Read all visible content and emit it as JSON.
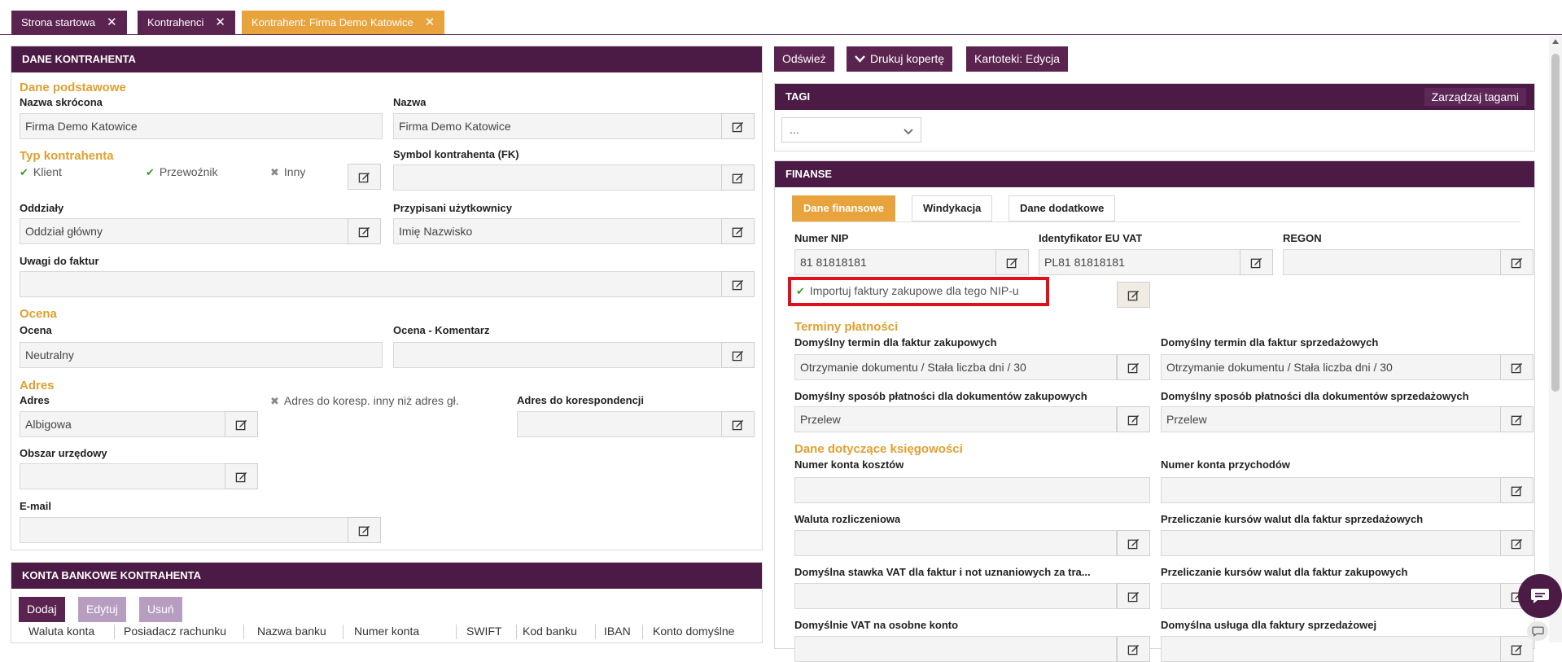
{
  "tabs": [
    {
      "label": "Strona startowa"
    },
    {
      "label": "Kontrahenci"
    },
    {
      "label": "Kontrahent: Firma Demo Katowice"
    }
  ],
  "close_glyph": "✕",
  "left": {
    "header": "DANE KONTRAHENTA",
    "basic_section": "Dane podstawowe",
    "short_name_label": "Nazwa skrócona",
    "short_name_value": "Firma Demo Katowice",
    "name_label": "Nazwa",
    "name_value": "Firma Demo Katowice",
    "type_section": "Typ kontrahenta",
    "type_options": [
      "Klient",
      "Przewoźnik",
      "Inny"
    ],
    "symbol_label": "Symbol kontrahenta (FK)",
    "symbol_value": "",
    "branches_label": "Oddziały",
    "branches_value": "Oddział główny",
    "users_label": "Przypisani użytkownicy",
    "users_value": "Imię Nazwisko",
    "invoice_notes_label": "Uwagi do faktur",
    "invoice_notes_value": "",
    "rating_section": "Ocena",
    "rating_label": "Ocena",
    "rating_value": "Neutralny",
    "rating_comment_label": "Ocena - Komentarz",
    "rating_comment_value": "",
    "address_section": "Adres",
    "address_label": "Adres",
    "address_value": "Albigowa",
    "corr_toggle": "Adres do koresp. inny niż adres gł.",
    "corr_label": "Adres do korespondencji",
    "corr_value": "",
    "office_label": "Obszar urzędowy",
    "office_value": "",
    "email_label": "E-mail",
    "email_value": ""
  },
  "bank": {
    "header": "KONTA BANKOWE KONTRAHENTA",
    "buttons": [
      "Dodaj",
      "Edytuj",
      "Usuń"
    ],
    "columns": [
      "Waluta konta",
      "Posiadacz rachunku",
      "Nazwa banku",
      "Numer konta",
      "SWIFT",
      "Kod banku",
      "IBAN",
      "Konto domyślne"
    ]
  },
  "right": {
    "toolbar": {
      "refresh": "Odśwież",
      "print": "Drukuj kopertę",
      "files": "Kartoteki: Edycja"
    },
    "tags_header": "TAGI",
    "manage_tags": "Zarządzaj tagami",
    "tags_select": "...",
    "finance_header": "FINANSE",
    "subtabs": [
      "Dane finansowe",
      "Windykacja",
      "Dane dodatkowe"
    ],
    "nip_label": "Numer NIP",
    "nip_value": "81 81818181",
    "euvat_label": "Identyfikator EU VAT",
    "euvat_value": "PL81 81818181",
    "regon_label": "REGON",
    "regon_value": "",
    "import_check": "Importuj faktury zakupowe dla tego NIP-u",
    "terms_section": "Terminy płatności",
    "term_purchase_label": "Domyślny termin dla faktur zakupowych",
    "term_purchase_value": "Otrzymanie dokumentu / Stała liczba dni / 30",
    "term_sales_label": "Domyślny termin dla faktur sprzedażowych",
    "term_sales_value": "Otrzymanie dokumentu / Stała liczba dni / 30",
    "pay_purchase_label": "Domyślny sposób płatności dla dokumentów zakupowych",
    "pay_purchase_value": "Przelew",
    "pay_sales_label": "Domyślny sposób płatności dla dokumentów sprzedażowych",
    "pay_sales_value": "Przelew",
    "acc_section": "Dane dotyczące księgowości",
    "cost_acc_label": "Numer konta kosztów",
    "cost_acc_value": "",
    "rev_acc_label": "Numer konta przychodów",
    "rev_acc_value": "",
    "currency_label": "Waluta rozliczeniowa",
    "currency_value": "",
    "fx_sales_label": "Przeliczanie kursów walut dla faktur sprzedażowych",
    "fx_sales_value": "",
    "vat_rate_label": "Domyślna stawka VAT dla faktur i not uznaniowych za tra...",
    "vat_rate_value": "",
    "fx_purchase_label": "Przeliczanie kursów walut dla faktur zakupowych",
    "fx_purchase_value": "",
    "vat_sep_label": "Domyślnie VAT na osobne konto",
    "service_label": "Domyślna usługa dla faktury sprzedażowej"
  },
  "colors": {
    "header": "#4b1b46",
    "tab": "#5b2450",
    "accent": "#e8a33c",
    "highlight": "#e0101a"
  }
}
